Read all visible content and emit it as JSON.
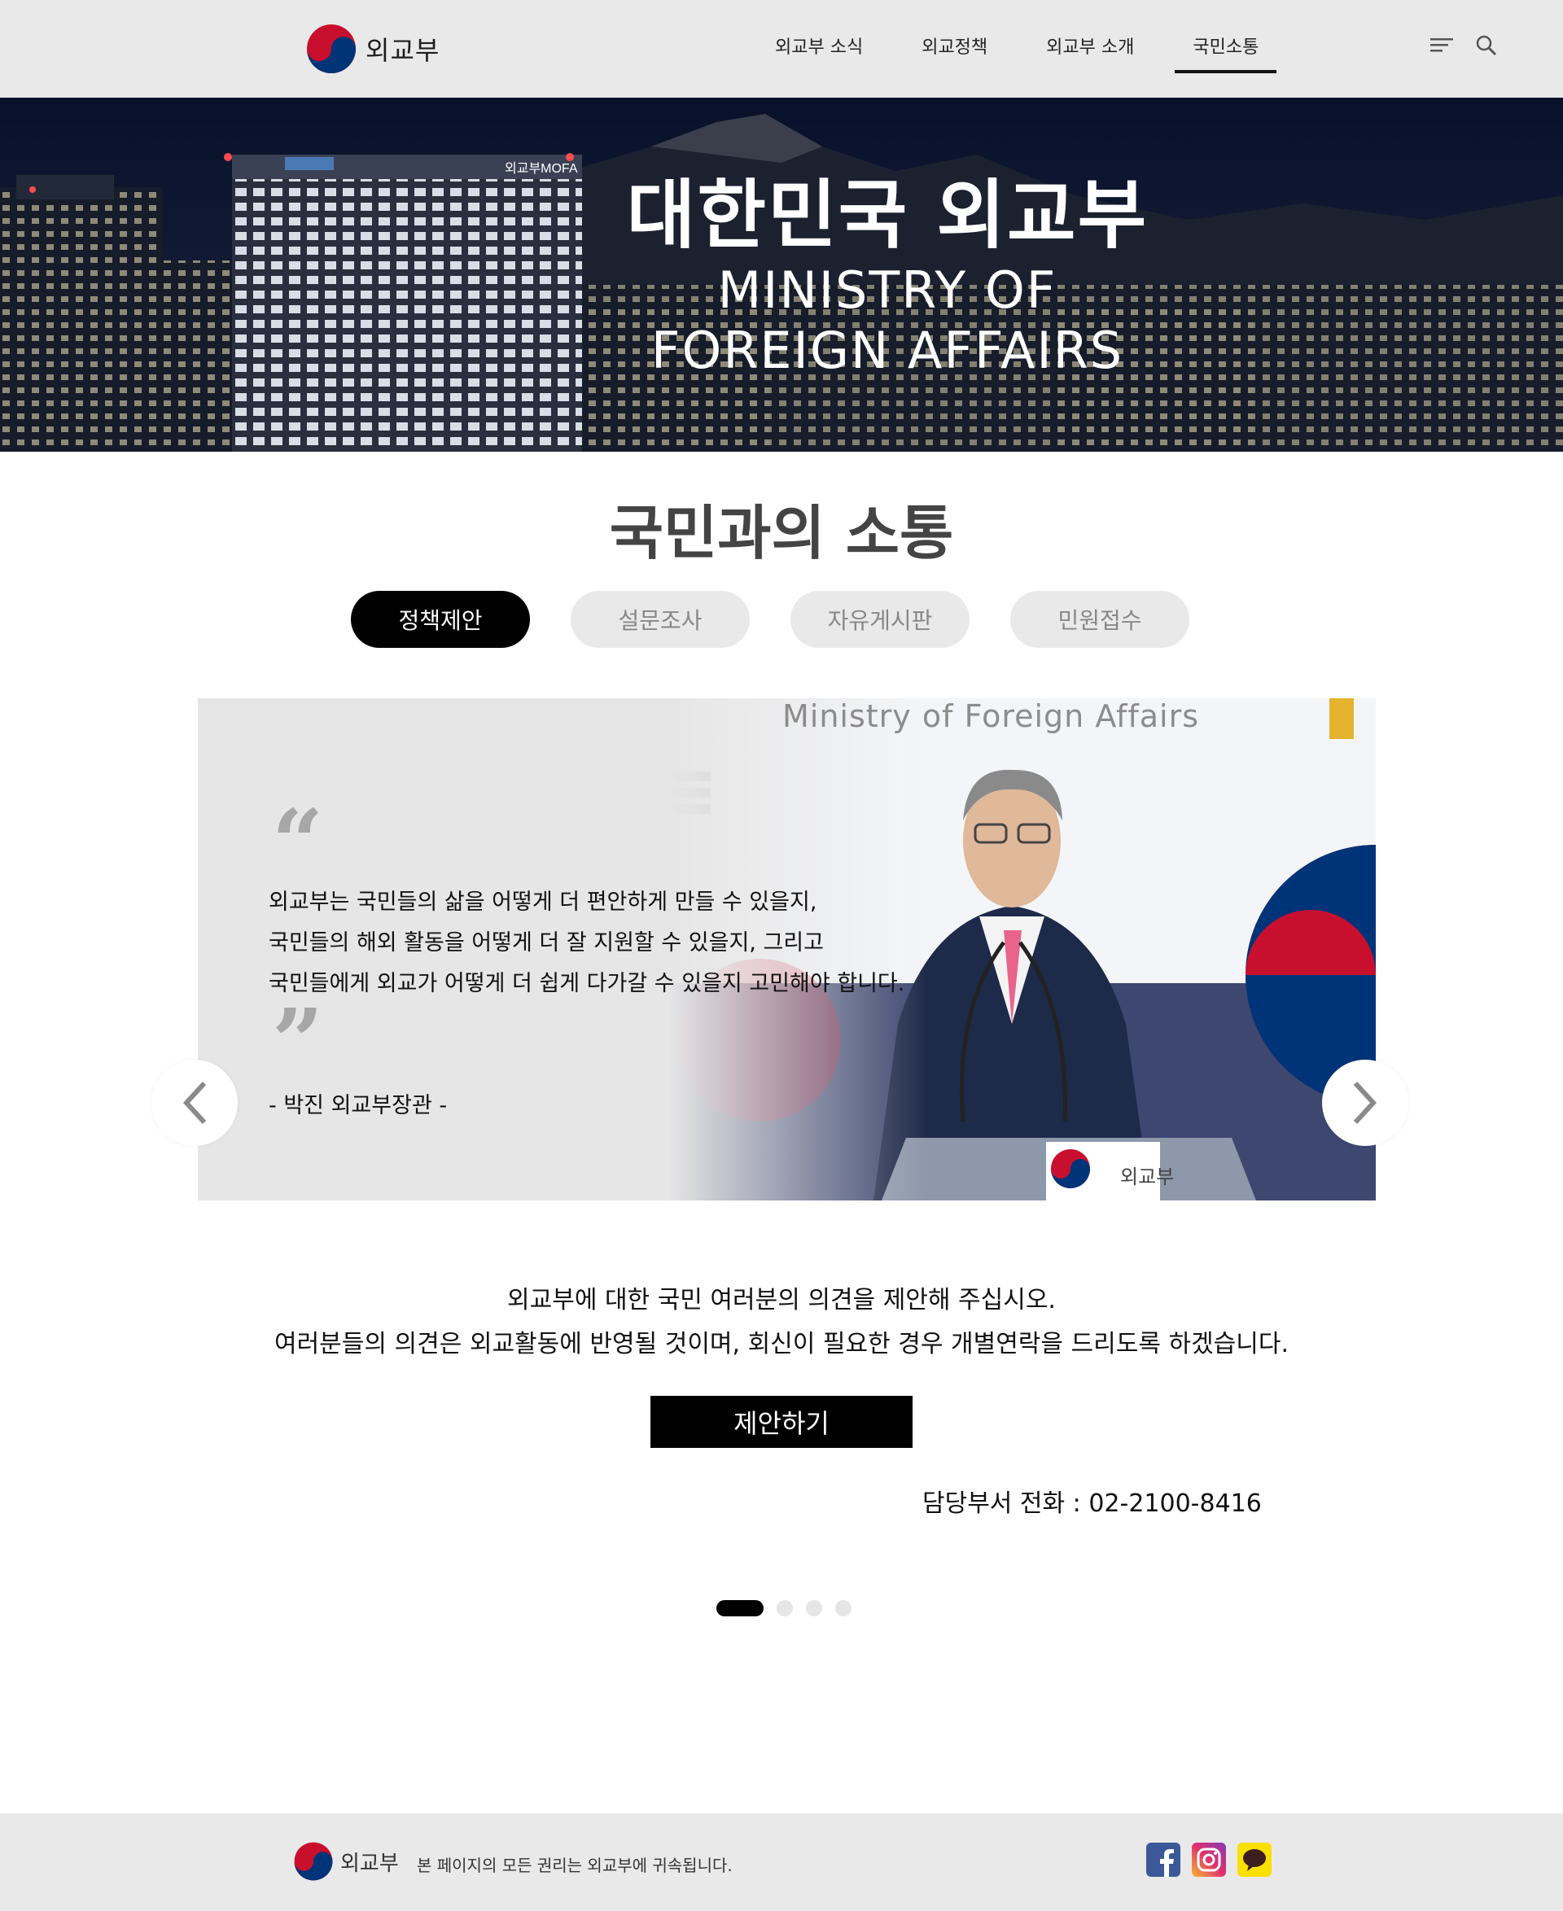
{
  "header": {
    "logo_text": "외교부",
    "nav": [
      "외교부 소식",
      "외교정책",
      "외교부 소개",
      "국민소통"
    ],
    "active_nav": 3
  },
  "hero": {
    "title": "대한민국 외교부",
    "subtitle_line1": "MINISTRY OF",
    "subtitle_line2": "FOREIGN AFFAIRS",
    "building_sign": "외교부MOFA"
  },
  "section": {
    "title": "국민과의 소통",
    "tabs": [
      "정책제안",
      "설문조사",
      "자유게시판",
      "민원접수"
    ],
    "active_tab": 0
  },
  "slide": {
    "banner_text": "Ministry of  Foreign Affairs",
    "quote_open": "“",
    "quote_close": "”",
    "quote_lines": [
      "외교부는 국민들의 삶을 어떻게 더 편안하게 만들 수 있을지,",
      "국민들의 해외 활동을 어떻게 더 잘 지원할 수 있을지, 그리고",
      "국민들에게 외교가 어떻게 더 쉽게 다가갈 수 있을지 고민해야 합니다."
    ],
    "author": "- 박진 외교부장관 -",
    "podium_label": "외교부"
  },
  "proposal": {
    "line1": "외교부에 대한 국민 여러분의 의견을 제안해 주십시오.",
    "line2": "여러분들의 의견은 외교활동에 반영될 것이며, 회신이 필요한 경우 개별연락을 드리도록 하겠습니다.",
    "button": "제안하기",
    "contact": "담당부서 전화 :  02-2100-8416"
  },
  "pagination": {
    "count": 4,
    "active": 0
  },
  "footer": {
    "logo_text": "외교부",
    "copyright": "본 페이지의 모든 권리는 외교부에 귀속됩니다."
  },
  "icons": {
    "menu": "menu-icon",
    "search": "search-icon",
    "prev": "chevron-left-icon",
    "next": "chevron-right-icon",
    "social": [
      "facebook-icon",
      "instagram-icon",
      "kakaotalk-icon"
    ]
  },
  "colors": {
    "taeguk_red": "#c8102e",
    "taeguk_blue": "#003478",
    "header_bg": "#e9e9e9",
    "active": "#000000"
  }
}
